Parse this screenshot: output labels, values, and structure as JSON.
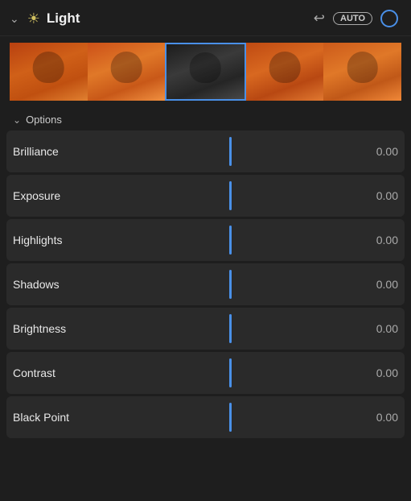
{
  "header": {
    "chevron": "chevron-down",
    "sun_symbol": "☀",
    "title": "Light",
    "undo_symbol": "↩",
    "auto_label": "AUTO"
  },
  "options": {
    "chevron": "chevron-down",
    "label": "Options"
  },
  "sliders": [
    {
      "label": "Brilliance",
      "value": "0.00"
    },
    {
      "label": "Exposure",
      "value": "0.00"
    },
    {
      "label": "Highlights",
      "value": "0.00"
    },
    {
      "label": "Shadows",
      "value": "0.00"
    },
    {
      "label": "Brightness",
      "value": "0.00"
    },
    {
      "label": "Contrast",
      "value": "0.00"
    },
    {
      "label": "Black Point",
      "value": "0.00"
    }
  ],
  "thumbnails": [
    {
      "id": "thumb-1"
    },
    {
      "id": "thumb-2"
    },
    {
      "id": "thumb-3-selected"
    },
    {
      "id": "thumb-4"
    },
    {
      "id": "thumb-5"
    }
  ]
}
